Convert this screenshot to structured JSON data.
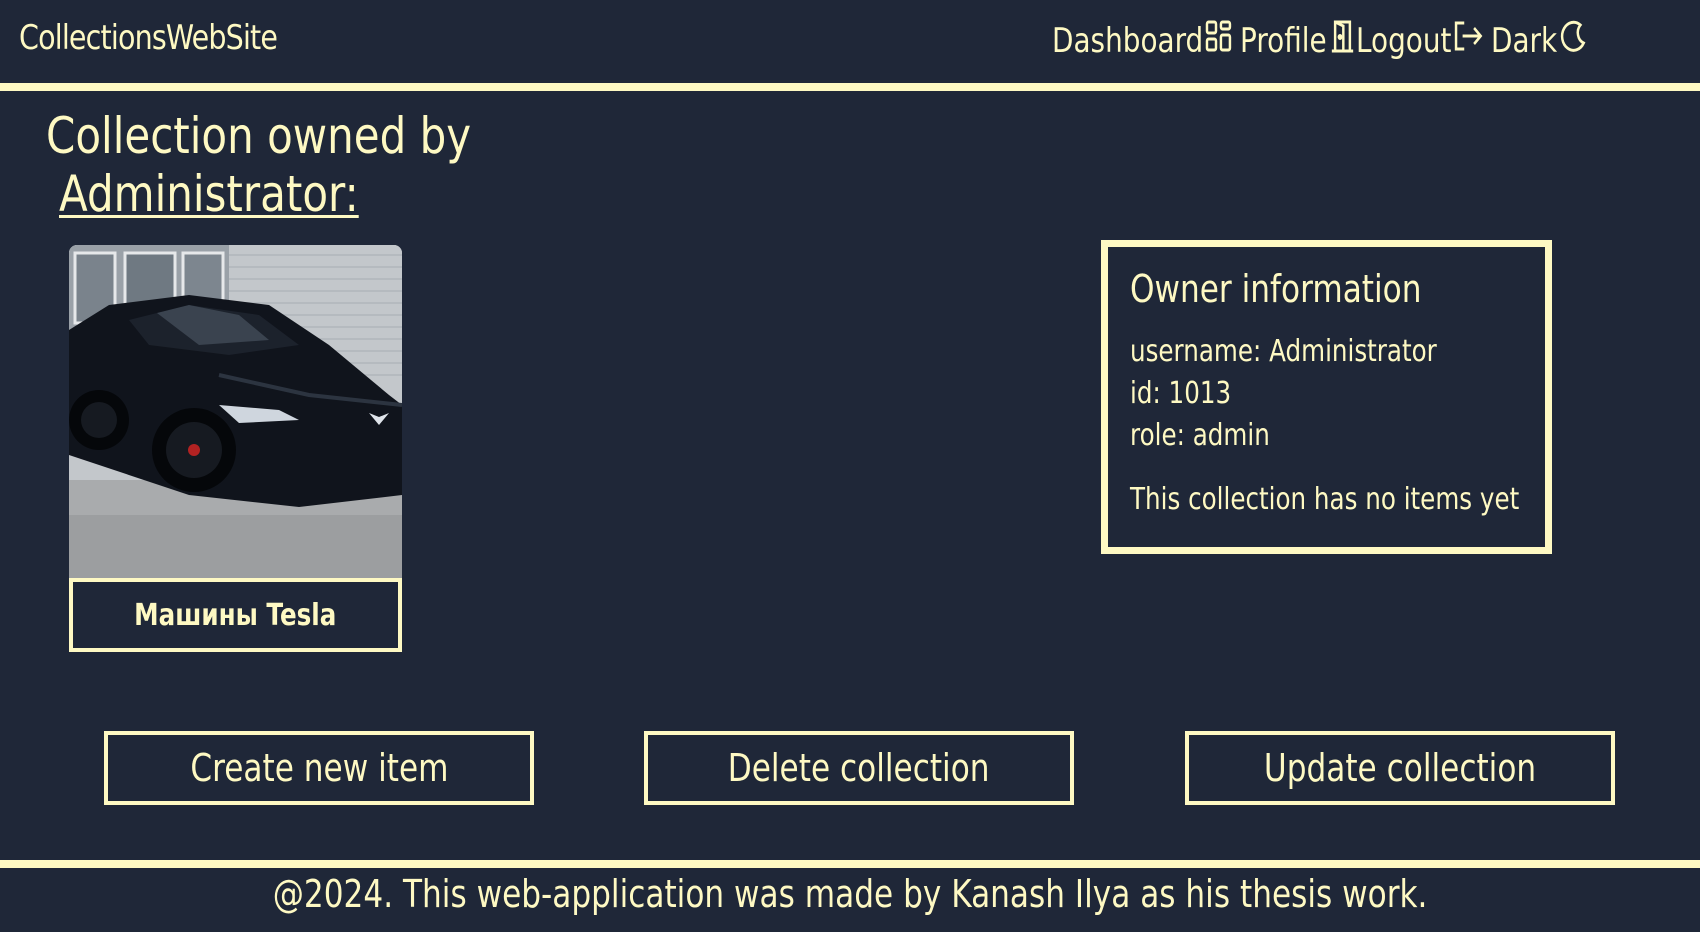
{
  "header": {
    "brand": "CollectionsWebSite",
    "nav": [
      {
        "label": "Dashboard",
        "icon": "dashboard-icon"
      },
      {
        "label": "Profile",
        "icon": "door-icon"
      },
      {
        "label": "Logout",
        "icon": "logout-icon"
      },
      {
        "label": "Dark",
        "icon": "moon-icon"
      }
    ]
  },
  "main": {
    "title": "Collection owned by",
    "owner_link": "Administrator:",
    "collection_card": {
      "name": "Машины Tesla",
      "image_description": "black car photo"
    },
    "owner_info": {
      "heading": "Owner information",
      "username": "username: Administrator",
      "id": "id: 1013",
      "role": "role: admin",
      "empty_message": "This collection has no items yet"
    },
    "buttons": {
      "create": "Create new item",
      "delete": "Delete collection",
      "update": "Update collection"
    }
  },
  "footer": {
    "text": "@2024. This web-application was made by Kanash Ilya as his thesis work."
  },
  "colors": {
    "background": "#1f2738",
    "accent": "#fef9c3"
  }
}
